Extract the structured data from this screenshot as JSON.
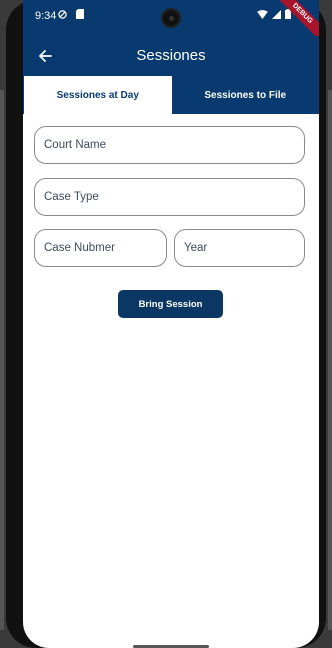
{
  "status_bar": {
    "time": "9:34",
    "debug_label": "DEBUG"
  },
  "app_bar": {
    "title": "Sessiones"
  },
  "tabs": [
    {
      "label": "Sessiones at Day",
      "active": true
    },
    {
      "label": "Sessiones to File",
      "active": false
    }
  ],
  "form": {
    "court_name_placeholder": "Court Name",
    "case_type_placeholder": "Case Type",
    "case_number_placeholder": "Case Nubmer",
    "year_placeholder": "Year"
  },
  "actions": {
    "bring_session_label": "Bring Session"
  },
  "colors": {
    "primary": "#083a70",
    "button": "#0b3765",
    "field_border": "#8a8a8a"
  }
}
